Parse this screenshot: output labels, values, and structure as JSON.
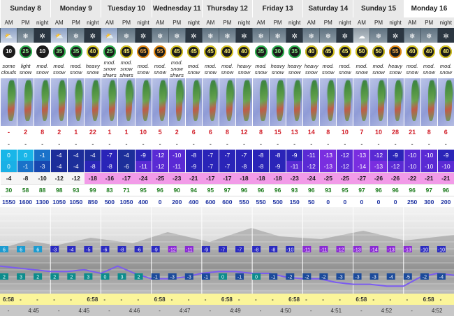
{
  "days": [
    {
      "name": "Sunday 8",
      "highlight": false
    },
    {
      "name": "Monday 9",
      "highlight": false
    },
    {
      "name": "Tuesday 10",
      "highlight": false
    },
    {
      "name": "Wednesday 11",
      "highlight": false
    },
    {
      "name": "Thursday 12",
      "highlight": false
    },
    {
      "name": "Friday 13",
      "highlight": false
    },
    {
      "name": "Saturday 14",
      "highlight": false
    },
    {
      "name": "Sunday 15",
      "highlight": false
    },
    {
      "name": "Monday 16",
      "highlight": true
    }
  ],
  "periods": [
    "AM",
    "PM",
    "night"
  ],
  "icons": [
    "sun-cloud",
    "snow",
    "night-snow",
    "sun-cloud",
    "snow",
    "night-snow",
    "sun-cloud",
    "snow",
    "night-snow",
    "snow",
    "snow",
    "night-snow",
    "snow",
    "snow",
    "night-snow",
    "snow",
    "snow",
    "night-snow",
    "snow",
    "snow",
    "night-snow",
    "cloud",
    "snow",
    "night-snow",
    "snow",
    "snow",
    "night-snow"
  ],
  "wind": [
    {
      "v": "10",
      "c": "w"
    },
    {
      "v": "25",
      "c": "g"
    },
    {
      "v": "10",
      "c": "w"
    },
    {
      "v": "35",
      "c": "g"
    },
    {
      "v": "35",
      "c": "g"
    },
    {
      "v": "40",
      "c": "y"
    },
    {
      "v": "25",
      "c": "g"
    },
    {
      "v": "45",
      "c": "y"
    },
    {
      "v": "65",
      "c": "o"
    },
    {
      "v": "55",
      "c": "o"
    },
    {
      "v": "45",
      "c": "y"
    },
    {
      "v": "45",
      "c": "y"
    },
    {
      "v": "45",
      "c": "y"
    },
    {
      "v": "40",
      "c": "y"
    },
    {
      "v": "40",
      "c": "y"
    },
    {
      "v": "35",
      "c": "g"
    },
    {
      "v": "30",
      "c": "g"
    },
    {
      "v": "35",
      "c": "g"
    },
    {
      "v": "40",
      "c": "y"
    },
    {
      "v": "45",
      "c": "y"
    },
    {
      "v": "45",
      "c": "y"
    },
    {
      "v": "50",
      "c": "y"
    },
    {
      "v": "50",
      "c": "y"
    },
    {
      "v": "55",
      "c": "o"
    },
    {
      "v": "40",
      "c": "y"
    },
    {
      "v": "40",
      "c": "y"
    },
    {
      "v": "40",
      "c": "y"
    }
  ],
  "summary": [
    "some clouds",
    "light snow",
    "mod. snow",
    "mod. snow",
    "mod. snow",
    "heavy snow",
    "mod. snow shwrs",
    "mod. snow shwrs",
    "mod. snow",
    "mod. snow",
    "mod. snow shwrs",
    "mod. snow",
    "mod. snow",
    "mod. snow",
    "heavy snow",
    "mod. snow",
    "heavy snow",
    "heavy snow",
    "heavy snow",
    "mod. snow",
    "mod. snow",
    "mod. snow",
    "mod. snow",
    "heavy snow",
    "mod. snow",
    "mod. snow",
    "mod. snow"
  ],
  "snow_cm": [
    "-",
    "2",
    "8",
    "2",
    "1",
    "22",
    "1",
    "1",
    "10",
    "5",
    "2",
    "6",
    "6",
    "8",
    "12",
    "8",
    "15",
    "13",
    "14",
    "8",
    "10",
    "7",
    "10",
    "28",
    "21",
    "8",
    "6"
  ],
  "rain_mm": [
    "-",
    "-",
    "-",
    "-",
    "-",
    "-",
    "-",
    "-",
    "-",
    "-",
    "-",
    "-",
    "-",
    "-",
    "-",
    "-",
    "-",
    "-",
    "-",
    "-",
    "-",
    "-",
    "-",
    "-",
    "-",
    "-",
    "-"
  ],
  "temp_max": [
    "0",
    "0",
    "-1",
    "-4",
    "-4",
    "-4",
    "-7",
    "-4",
    "-9",
    "-12",
    "-10",
    "-8",
    "-7",
    "-7",
    "-7",
    "-8",
    "-8",
    "-9",
    "-11",
    "-13",
    "-12",
    "-13",
    "-12",
    "-9",
    "-10",
    "-10",
    "-9"
  ],
  "temp_min": [
    "0",
    "-1",
    "-3",
    "-4",
    "-4",
    "-8",
    "-8",
    "-6",
    "-11",
    "-12",
    "-11",
    "-9",
    "-7",
    "-7",
    "-8",
    "-8",
    "-9",
    "-11",
    "-12",
    "-13",
    "-12",
    "-14",
    "-13",
    "-12",
    "-10",
    "-10",
    "-10"
  ],
  "chill": [
    "-4",
    "-8",
    "-10",
    "-12",
    "-12",
    "-18",
    "-16",
    "-17",
    "-24",
    "-25",
    "-23",
    "-21",
    "-17",
    "-17",
    "-18",
    "-18",
    "-18",
    "-23",
    "-24",
    "-25",
    "-25",
    "-27",
    "-26",
    "-26",
    "-22",
    "-21",
    "-21"
  ],
  "humidity": [
    "30",
    "58",
    "88",
    "98",
    "93",
    "99",
    "83",
    "71",
    "95",
    "96",
    "90",
    "94",
    "95",
    "97",
    "96",
    "96",
    "96",
    "93",
    "96",
    "93",
    "95",
    "97",
    "96",
    "96",
    "96",
    "97",
    "96"
  ],
  "freezing": [
    "1550",
    "1600",
    "1300",
    "1050",
    "1050",
    "850",
    "500",
    "1050",
    "400",
    "0",
    "200",
    "400",
    "600",
    "600",
    "550",
    "550",
    "500",
    "150",
    "50",
    "0",
    "0",
    "0",
    "0",
    "0",
    "250",
    "300",
    "200"
  ],
  "chart": {
    "upper": [
      "6",
      "6",
      "6",
      "-3",
      "-4",
      "-5",
      "-6",
      "-8",
      "-6",
      "-9",
      "-12",
      "-11",
      "-9",
      "-7",
      "-7",
      "-8",
      "-8",
      "-10",
      "-11",
      "-11",
      "-12",
      "-13",
      "-14",
      "-13",
      "-13",
      "-10",
      "-10",
      "-10"
    ],
    "lower": [
      "2",
      "3",
      "2",
      "2",
      "2",
      "3",
      "0",
      "3",
      "2",
      "-1",
      "-3",
      "-3",
      "-1",
      "0",
      "-1",
      "0",
      "-1",
      "-2",
      "-2",
      "-2",
      "-3",
      "-3",
      "-3",
      "-4",
      "-5",
      "-2",
      "-4",
      "-2"
    ],
    "line": [
      2,
      1,
      0,
      -1,
      -1,
      0,
      -2,
      2,
      -2,
      -5,
      -5,
      -4,
      -2,
      -1,
      -1,
      -2,
      -2,
      -4,
      -5,
      -5,
      -7,
      -8,
      -8,
      -9,
      -9,
      -4,
      -2,
      -3
    ]
  },
  "sunrise": [
    "6:58",
    "-",
    "-",
    "-",
    "-",
    "6:58",
    "-",
    "-",
    "-",
    "6:58",
    "-",
    "-",
    "-",
    "6:58",
    "-",
    "-",
    "-",
    "6:58",
    "-",
    "-",
    "-",
    "6:58",
    "-",
    "-",
    "-",
    "6:58",
    "-"
  ],
  "sunset": [
    "-",
    "4:45",
    "-",
    "4:45",
    "-",
    "4:46",
    "-",
    "4:47",
    "-",
    "4:49",
    "-",
    "4:50",
    "-",
    "4:51",
    "-",
    "4:52",
    "-",
    "4:52",
    "-"
  ],
  "colors": {
    "chart_line": "#7b5cf0",
    "upper_box": "#1a1aa8",
    "lower_box": "#0a7a9a"
  }
}
